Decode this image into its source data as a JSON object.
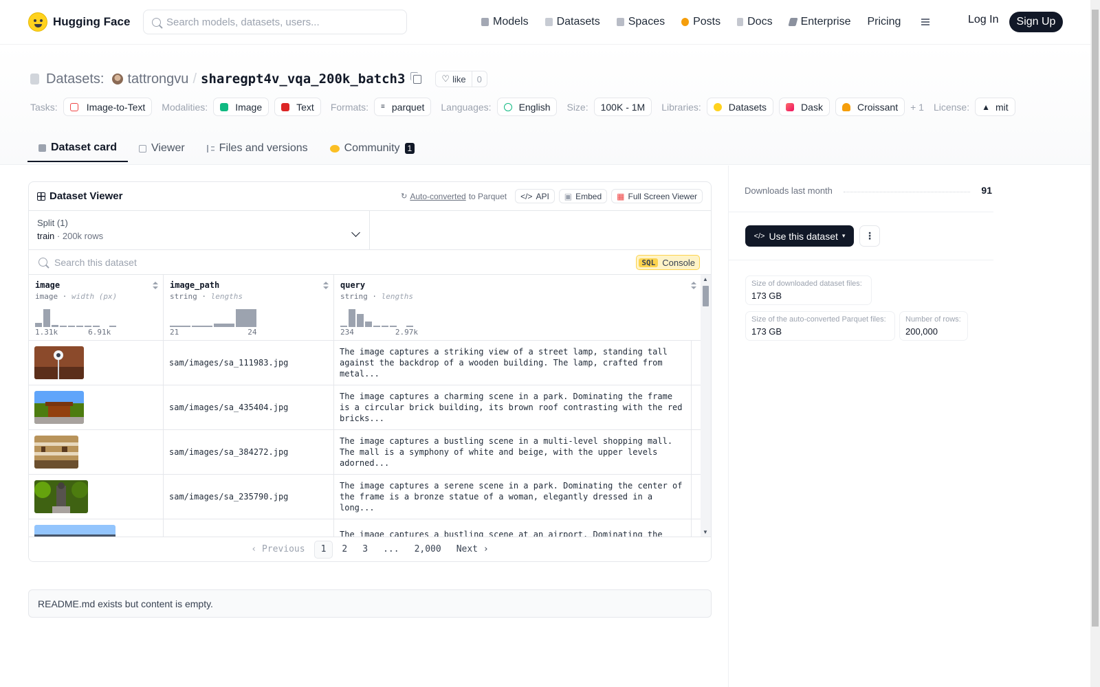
{
  "header": {
    "brand": "Hugging Face",
    "search_placeholder": "Search models, datasets, users...",
    "nav": [
      {
        "label": "Models",
        "color": "#a3a8b4"
      },
      {
        "label": "Datasets",
        "color": "#c7cbd3"
      },
      {
        "label": "Spaces",
        "color": "#b8bcc6"
      },
      {
        "label": "Posts",
        "color": "#f59e0b"
      },
      {
        "label": "Docs",
        "color": "#c4c7cf"
      },
      {
        "label": "Enterprise",
        "color": "#8b919e"
      },
      {
        "label": "Pricing",
        "color": ""
      }
    ],
    "login": "Log In",
    "signup": "Sign Up"
  },
  "repo": {
    "section": "Datasets:",
    "owner": "tattrongvu",
    "separator": "/",
    "name": "sharegpt4v_vqa_200k_batch3",
    "like_label": "like",
    "like_count": "0"
  },
  "tags": {
    "tasks_label": "Tasks:",
    "task": "Image-to-Text",
    "modalities_label": "Modalities:",
    "modality_image": "Image",
    "modality_text": "Text",
    "formats_label": "Formats:",
    "format": "parquet",
    "languages_label": "Languages:",
    "language": "English",
    "size_label": "Size:",
    "size": "100K - 1M",
    "libraries_label": "Libraries:",
    "lib1": "Datasets",
    "lib2": "Dask",
    "lib3": "Croissant",
    "more": "+ 1",
    "license_label": "License:",
    "license": "mit"
  },
  "tabs": {
    "dataset_card": "Dataset card",
    "viewer": "Viewer",
    "files": "Files and versions",
    "community": "Community",
    "community_count": "1"
  },
  "viewer": {
    "title": "Dataset Viewer",
    "auto_converted": "Auto-converted",
    "to_parquet": "to Parquet",
    "api": "API",
    "embed": "Embed",
    "fullscreen": "Full Screen Viewer",
    "split_label": "Split (1)",
    "split_name": "train",
    "split_rows": "200k rows",
    "search_placeholder": "Search this dataset",
    "sql_badge": "SQL",
    "sql_console": "Console",
    "columns": [
      {
        "name": "image",
        "type": "image",
        "stat": "width (px)",
        "min": "1.31k",
        "max": "6.91k",
        "hist": [
          0.25,
          1.0,
          0.12,
          0.06,
          0.06,
          0.06,
          0.06,
          0.06,
          0.0,
          0.06
        ]
      },
      {
        "name": "image_path",
        "type": "string",
        "stat": "lengths",
        "min": "21",
        "max": "24",
        "hist": [
          0.06,
          0.06,
          0.2,
          1.0
        ]
      },
      {
        "name": "query",
        "type": "string",
        "stat": "lengths",
        "min": "234",
        "max": "2.97k",
        "hist": [
          0.08,
          1.0,
          0.75,
          0.3,
          0.06,
          0.06,
          0.06,
          0.0,
          0.06
        ]
      }
    ],
    "rows": [
      {
        "path": "sam/images/sa_111983.jpg",
        "query": "The image captures a striking view of a street lamp, standing tall against the backdrop of a wooden building. The lamp, crafted from metal..."
      },
      {
        "path": "sam/images/sa_435404.jpg",
        "query": "The image captures a charming scene in a park. Dominating the frame is a circular brick building, its brown roof contrasting with the red bricks..."
      },
      {
        "path": "sam/images/sa_384272.jpg",
        "query": "The image captures a bustling scene in a multi-level shopping mall. The mall is a symphony of white and beige, with the upper levels adorned..."
      },
      {
        "path": "sam/images/sa_235790.jpg",
        "query": "The image captures a serene scene in a park. Dominating the center of the frame is a bronze statue of a woman, elegantly dressed in a long..."
      },
      {
        "path": "",
        "query": "The image captures a bustling scene at an airport. Dominating the frame..."
      }
    ],
    "pager": {
      "prev": "Previous",
      "p1": "1",
      "p2": "2",
      "p3": "3",
      "dots": "...",
      "last": "2,000",
      "next": "Next"
    }
  },
  "readme_note": "README.md exists but content is empty.",
  "sidebar": {
    "downloads_label": "Downloads last month",
    "downloads_value": "91",
    "use_dataset": "Use this dataset",
    "size_dl_label": "Size of downloaded dataset files:",
    "size_dl_value": "173 GB",
    "size_parquet_label": "Size of the auto-converted Parquet files:",
    "size_parquet_value": "173 GB",
    "rows_label": "Number of rows:",
    "rows_value": "200,000"
  }
}
